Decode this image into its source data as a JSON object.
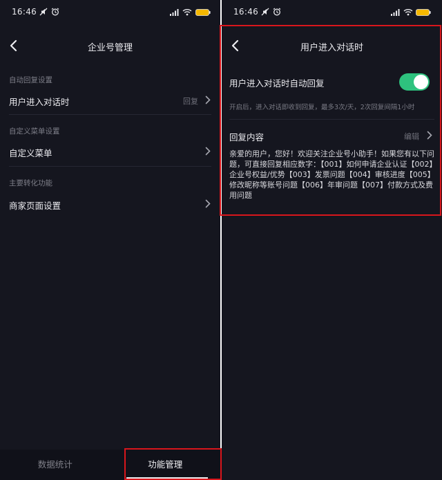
{
  "colors": {
    "background": "#15161f",
    "tab_background": "#101119",
    "toggle_on": "#2ec27e",
    "highlight_box": "#d9161c"
  },
  "status_bar": {
    "time": "16:46",
    "icons": [
      "mute-icon",
      "alarm-icon",
      "signal-icon",
      "wifi-icon",
      "battery-icon"
    ]
  },
  "left_screen": {
    "title": "企业号管理",
    "sections": [
      {
        "label": "自动回复设置",
        "row": {
          "label": "用户进入对话时",
          "value": "回复"
        }
      },
      {
        "label": "自定义菜单设置",
        "row": {
          "label": "自定义菜单",
          "value": ""
        }
      },
      {
        "label": "主要转化功能",
        "row": {
          "label": "商家页面设置",
          "value": ""
        }
      }
    ],
    "tabs": [
      {
        "label": "数据统计",
        "active": false
      },
      {
        "label": "功能管理",
        "active": true
      }
    ]
  },
  "right_screen": {
    "title": "用户进入对话时",
    "auto_reply_label": "用户进入对话时自动回复",
    "auto_reply_enabled": true,
    "hint": "开启后，进入对话即收到回复，最多3次/天，2次回复间隔1小时",
    "reply_content_label": "回复内容",
    "edit_label": "编辑",
    "reply_text": "亲爱的用户，您好！欢迎关注企业号小助手！如果您有以下问题，可直接回复相应数字：【001】如何申请企业认证【002】企业号权益/优势【003】发票问题【004】审核进度【005】修改昵称等账号问题【006】年审问题【007】付款方式及费用问题"
  }
}
